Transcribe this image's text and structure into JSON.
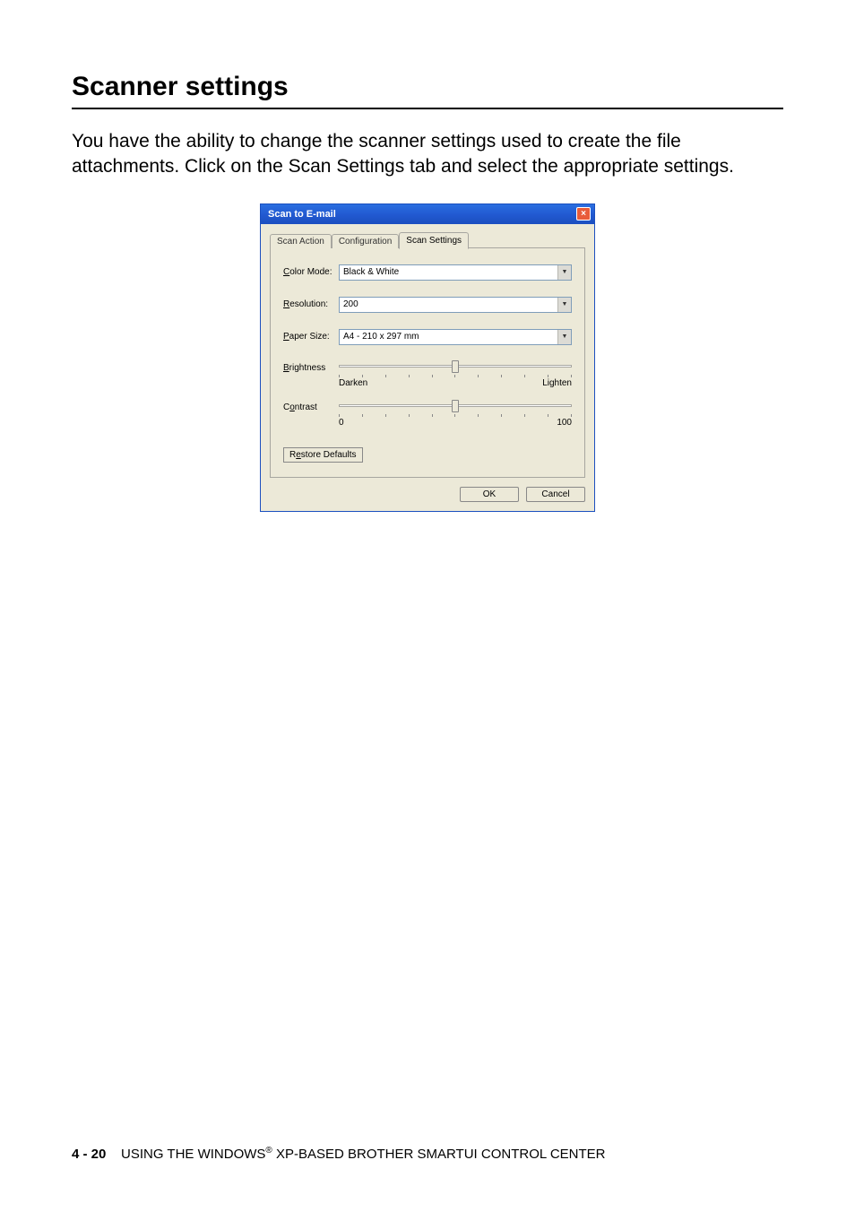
{
  "heading": "Scanner settings",
  "body_text": "You have the ability to change the scanner settings used to create the file attachments. Click on the Scan Settings tab and select the appropriate settings.",
  "dialog": {
    "title": "Scan to E-mail",
    "tabs": [
      "Scan Action",
      "Configuration",
      "Scan Settings"
    ],
    "active_tab": 2,
    "fields": {
      "color_mode": {
        "label": "Color Mode:",
        "value": "Black & White"
      },
      "resolution": {
        "label": "Resolution:",
        "value": "200"
      },
      "paper_size": {
        "label": "Paper Size:",
        "value": "A4 - 210 x 297 mm"
      }
    },
    "sliders": {
      "brightness": {
        "label": "Brightness",
        "left": "Darken",
        "right": "Lighten"
      },
      "contrast": {
        "label": "Contrast",
        "left": "0",
        "right": "100"
      }
    },
    "restore": "Restore Defaults",
    "ok": "OK",
    "cancel": "Cancel"
  },
  "footer": {
    "page": "4 - 20",
    "text_before": "USING THE WINDOWS",
    "reg": "®",
    "text_after": " XP-BASED BROTHER SMARTUI CONTROL CENTER"
  }
}
